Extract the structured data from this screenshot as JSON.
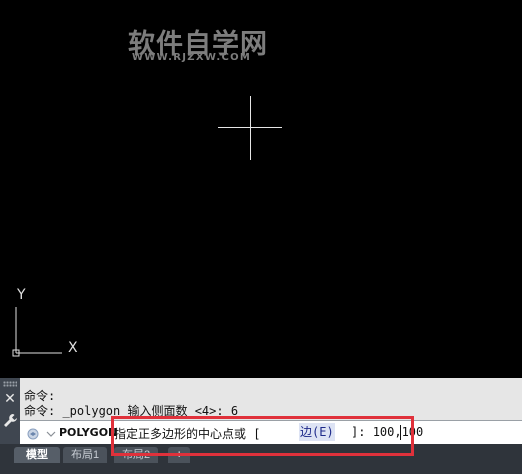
{
  "watermark": {
    "title": "软件自学网",
    "url": "WWW.RJZXW.COM"
  },
  "ucs": {
    "y_label": "Y",
    "x_label": "X"
  },
  "command_panel": {
    "close_icon": "close-icon",
    "settings_icon": "wrench-icon",
    "history": [
      "命令:",
      "命令: _polygon 输入侧面数 <4>: 6"
    ],
    "command_name": "POLYGON",
    "prompt_text": "指定正多边形的中心点或 [",
    "option_label": "边(E)",
    "prompt_suffix": "]:",
    "input_value": "100,100"
  },
  "tabs": [
    {
      "label": "模型",
      "active": true
    },
    {
      "label": "布局1",
      "active": false
    },
    {
      "label": "布局2",
      "active": false
    },
    {
      "label": "+",
      "active": false
    }
  ],
  "colors": {
    "canvas_bg": "#000000",
    "panel_bg": "#e6e6e6",
    "tab_bar_bg": "#2f343b",
    "highlight_border": "#e0313b",
    "option_highlight_bg": "#dde3f4"
  }
}
